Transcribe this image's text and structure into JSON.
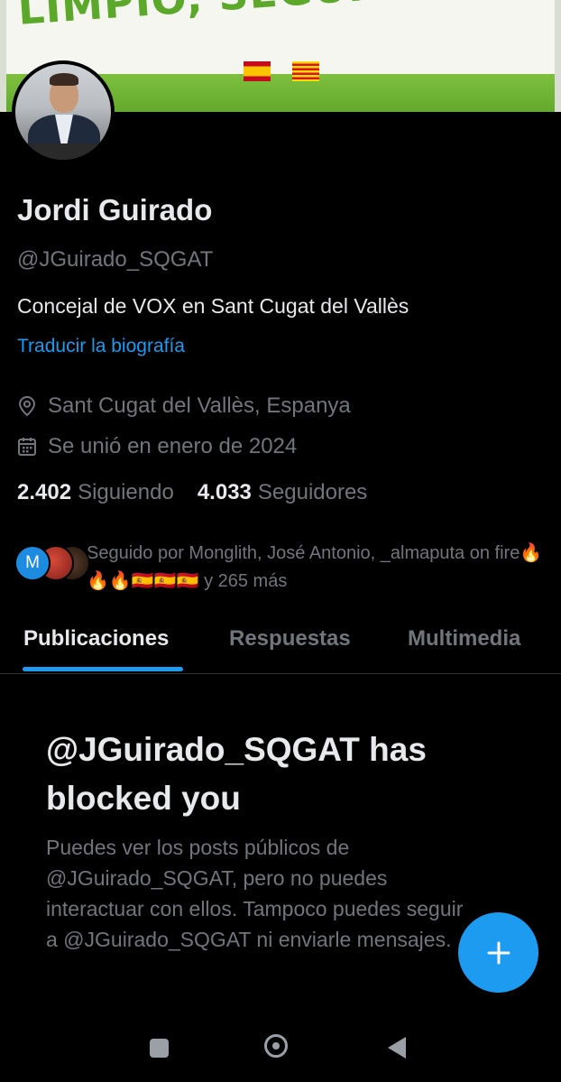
{
  "banner": {
    "slogan": "LIMPIO, SEGURO Y EN ORDEN",
    "colors": {
      "green": "#5ba82a",
      "background": "#f4f6ef"
    }
  },
  "profile": {
    "name": "Jordi Guirado",
    "handle": "@JGuirado_SQGAT",
    "bio": "Concejal de VOX en Sant Cugat del Vallès",
    "translate_bio": "Traducir la biografía",
    "location": "Sant Cugat del Vallès, Espanya",
    "joined": "Se unió en enero de 2024",
    "following_count": "2.402",
    "following_label": "Siguiendo",
    "followers_count": "4.033",
    "followers_label": "Seguidores"
  },
  "followed_by": {
    "avatar_initial": "M",
    "text": "Seguido por Monglith, José Antonio, _almaputa on fire🔥🔥🔥🇪🇸🇪🇸🇪🇸 y 265 más"
  },
  "tabs": {
    "items": [
      {
        "label": "Publicaciones",
        "active": true
      },
      {
        "label": "Respuestas",
        "active": false
      },
      {
        "label": "Multimedia",
        "active": false
      }
    ]
  },
  "blocked": {
    "title": "@JGuirado_SQGAT has blocked you",
    "body": "Puedes ver los posts públicos de @JGuirado_SQGAT, pero no puedes interactuar con ellos. Tampoco puedes seguir a @JGuirado_SQGAT ni enviarle mensajes."
  },
  "fab": {
    "icon": "plus-icon"
  },
  "navbar": {
    "icons": [
      "recent-apps-icon",
      "home-icon",
      "back-icon"
    ]
  },
  "colors": {
    "accent": "#1d9bf0",
    "text_primary": "#e7e9ea",
    "text_secondary": "#71767b",
    "background": "#000000"
  }
}
